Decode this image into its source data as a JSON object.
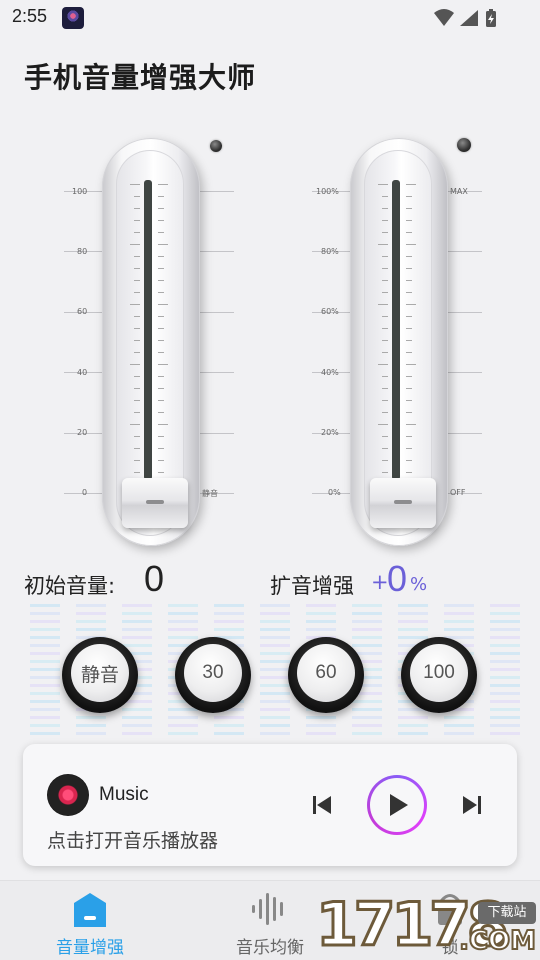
{
  "status_bar": {
    "time": "2:55",
    "icons": [
      "wifi-icon",
      "signal-icon",
      "battery-icon"
    ]
  },
  "app": {
    "title": "手机音量增强大师"
  },
  "left_slider": {
    "scale_labels": [
      "100",
      "80",
      "60",
      "40",
      "20",
      "0"
    ],
    "end_label": "静音",
    "level": 0
  },
  "right_slider": {
    "scale_labels": [
      "100%",
      "80%",
      "60%",
      "40%",
      "20%",
      "0%"
    ],
    "top_label": "MAX",
    "end_label": "OFF",
    "level": 0
  },
  "readouts": {
    "initial_volume_label": "初始音量:",
    "initial_volume_value": "0",
    "boost_label": "扩音增强",
    "boost_sign": "+",
    "boost_value": "0",
    "boost_unit": "%"
  },
  "presets": [
    "静音",
    "30",
    "60",
    "100"
  ],
  "player": {
    "title": "Music",
    "subtitle": "点击打开音乐播放器"
  },
  "bottom_nav": {
    "items": [
      {
        "label": "音量增强",
        "icon": "volume-boost-icon",
        "active": true
      },
      {
        "label": "音乐均衡",
        "icon": "equalizer-icon",
        "active": false
      },
      {
        "label": "锁",
        "icon": "lock-icon",
        "active": false
      }
    ]
  },
  "watermark": {
    "digits": "17178",
    "badge": "下载站",
    "suffix": ".COM"
  },
  "colors": {
    "accent_purple": "#6b60d8",
    "nav_active": "#2aa0e8",
    "play_ring": "#c23cd9"
  }
}
